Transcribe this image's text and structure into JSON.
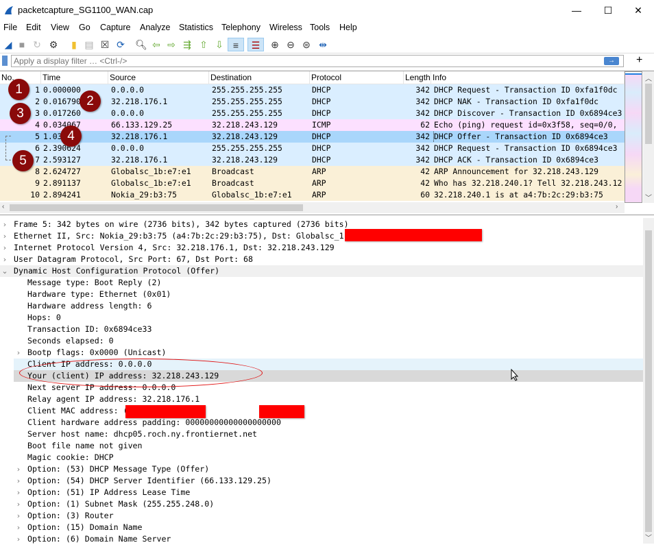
{
  "window": {
    "title": "packetcapture_SG1100_WAN.cap",
    "minimize": "—",
    "maximize": "☐",
    "close": "✕"
  },
  "menu": [
    "File",
    "Edit",
    "View",
    "Go",
    "Capture",
    "Analyze",
    "Statistics",
    "Telephony",
    "Wireless",
    "Tools",
    "Help"
  ],
  "toolbar": [
    "start-capture",
    "stop-capture",
    "restart-capture",
    "capture-options",
    "open-file",
    "save-file",
    "close-file",
    "reload-file",
    "find-packet",
    "go-back",
    "go-forward",
    "go-to-packet",
    "go-first",
    "go-last",
    "auto-scroll",
    "colorize",
    "zoom-in",
    "zoom-out",
    "normal-size",
    "resize-columns"
  ],
  "filter": {
    "placeholder": "Apply a display filter … <Ctrl-/>",
    "apply": "→",
    "add": "+"
  },
  "packet_list": {
    "columns": [
      "No.",
      "Time",
      "Source",
      "Destination",
      "Protocol",
      "Length",
      "Info"
    ],
    "rows": [
      {
        "no": "1",
        "time": "0.000000",
        "src": "0.0.0.0",
        "dst": "255.255.255.255",
        "proto": "DHCP",
        "len": "342",
        "info": "DHCP Request  - Transaction ID 0xfa1f0dc",
        "color": "#daeeff"
      },
      {
        "no": "2",
        "time": "0.016790",
        "src": "32.218.176.1",
        "dst": "255.255.255.255",
        "proto": "DHCP",
        "len": "342",
        "info": "DHCP NAK      - Transaction ID 0xfa1f0dc",
        "color": "#daeeff"
      },
      {
        "no": "3",
        "time": "0.017260",
        "src": "0.0.0.0",
        "dst": "255.255.255.255",
        "proto": "DHCP",
        "len": "342",
        "info": "DHCP Discover - Transaction ID 0x6894ce3",
        "color": "#daeeff"
      },
      {
        "no": "4",
        "time": "0.034067",
        "src": "66.133.129.25",
        "dst": "32.218.243.129",
        "proto": "ICMP",
        "len": "62",
        "info": "Echo (ping) request  id=0x3f58, seq=0/0,",
        "color": "#fce0ff"
      },
      {
        "no": "5",
        "time": "1.03",
        "src": "32.218.176.1",
        "dst": "32.218.243.129",
        "proto": "DHCP",
        "len": "342",
        "info": "DHCP Offer    - Transaction ID 0x6894ce3",
        "color": "#a9d6fb"
      },
      {
        "no": "6",
        "time": "2.390624",
        "src": "0.0.0.0",
        "dst": "255.255.255.255",
        "proto": "DHCP",
        "len": "342",
        "info": "DHCP Request  - Transaction ID 0x6894ce3",
        "color": "#daeeff"
      },
      {
        "no": "7",
        "time": "2.593127",
        "src": "32.218.176.1",
        "dst": "32.218.243.129",
        "proto": "DHCP",
        "len": "342",
        "info": "DHCP ACK      - Transaction ID 0x6894ce3",
        "color": "#daeeff"
      },
      {
        "no": "8",
        "time": "2.624727",
        "src": "Globalsc_1b:e7:e1",
        "dst": "Broadcast",
        "proto": "ARP",
        "len": "42",
        "info": "ARP Announcement for 32.218.243.129",
        "color": "#faf0d7"
      },
      {
        "no": "9",
        "time": "2.891137",
        "src": "Globalsc_1b:e7:e1",
        "dst": "Broadcast",
        "proto": "ARP",
        "len": "42",
        "info": "Who has 32.218.240.1? Tell 32.218.243.12",
        "color": "#faf0d7"
      },
      {
        "no": "10",
        "time": "2.894241",
        "src": "Nokia_29:b3:75",
        "dst": "Globalsc_1b:e7:e1",
        "proto": "ARP",
        "len": "60",
        "info": "32.218.240.1 is at a4:7b:2c:29:b3:75",
        "color": "#faf0d7"
      }
    ]
  },
  "annotations": [
    "1",
    "2",
    "3",
    "4",
    "5"
  ],
  "details": [
    {
      "text": "Frame 5: 342 bytes on wire (2736 bits), 342 bytes captured (2736 bits)",
      "arrow": "›",
      "indent": 0
    },
    {
      "text": "Ethernet II, Src: Nokia_29:b3:75 (a4:7b:2c:29:b3:75), Dst: Globalsc_1",
      "arrow": "›",
      "indent": 0
    },
    {
      "text": "Internet Protocol Version 4, Src: 32.218.176.1, Dst: 32.218.243.129",
      "arrow": "›",
      "indent": 0
    },
    {
      "text": "User Datagram Protocol, Src Port: 67, Dst Port: 68",
      "arrow": "›",
      "indent": 0
    },
    {
      "text": "Dynamic Host Configuration Protocol (Offer)",
      "arrow": "⌄",
      "indent": 0,
      "bg": "#f0f0f0"
    },
    {
      "text": "Message type: Boot Reply (2)",
      "indent": 1
    },
    {
      "text": "Hardware type: Ethernet (0x01)",
      "indent": 1
    },
    {
      "text": "Hardware address length: 6",
      "indent": 1
    },
    {
      "text": "Hops: 0",
      "indent": 1
    },
    {
      "text": "Transaction ID: 0x6894ce33",
      "indent": 1
    },
    {
      "text": "Seconds elapsed: 0",
      "indent": 1
    },
    {
      "text": "Bootp flags: 0x0000 (Unicast)",
      "arrow": "›",
      "indent": 1
    },
    {
      "text": "Client IP address: 0.0.0.0",
      "indent": 1,
      "bg": "#e5f3fb"
    },
    {
      "text": "Your (client) IP address: 32.218.243.129",
      "indent": 1,
      "bg": "#d9d9d9"
    },
    {
      "text": "Next server IP address: 0.0.0.0",
      "indent": 1
    },
    {
      "text": "Relay agent IP address: 32.218.176.1",
      "indent": 1
    },
    {
      "text": "Client MAC address: (                 (f0:ad:4e:",
      "indent": 1
    },
    {
      "text": "Client hardware address padding: 00000000000000000000",
      "indent": 1
    },
    {
      "text": "Server host name: dhcp05.roch.ny.frontiernet.net",
      "indent": 1
    },
    {
      "text": "Boot file name not given",
      "indent": 1
    },
    {
      "text": "Magic cookie: DHCP",
      "indent": 1
    },
    {
      "text": "Option: (53) DHCP Message Type (Offer)",
      "arrow": "›",
      "indent": 1
    },
    {
      "text": "Option: (54) DHCP Server Identifier (66.133.129.25)",
      "arrow": "›",
      "indent": 1
    },
    {
      "text": "Option: (51) IP Address Lease Time",
      "arrow": "›",
      "indent": 1
    },
    {
      "text": "Option: (1) Subnet Mask (255.255.248.0)",
      "arrow": "›",
      "indent": 1
    },
    {
      "text": "Option: (3) Router",
      "arrow": "›",
      "indent": 1
    },
    {
      "text": "Option: (15) Domain Name",
      "arrow": "›",
      "indent": 1
    },
    {
      "text": "Option: (6) Domain Name Server",
      "arrow": "›",
      "indent": 1
    }
  ],
  "colors": {
    "annotation": "#8a0a0a",
    "highlight": "#e01010",
    "redaction": "#ff0000"
  }
}
